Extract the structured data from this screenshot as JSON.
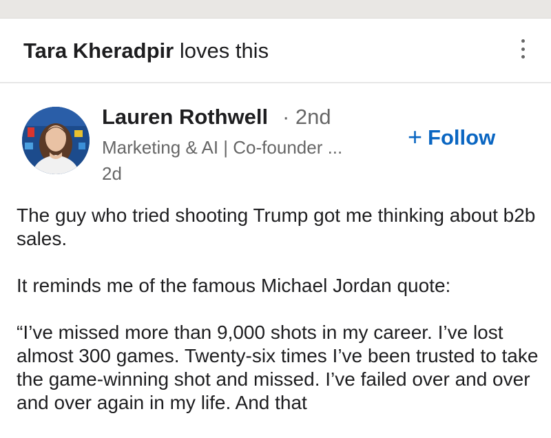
{
  "activity": {
    "actor_name": "Tara Kheradpir",
    "action_text": "loves this",
    "more_icon": "three-dots-vertical-icon"
  },
  "post": {
    "author": {
      "name": "Lauren Rothwell",
      "degree": "· 2nd",
      "headline": "Marketing & AI | Co-founder ...",
      "time": "2d"
    },
    "follow_button": {
      "plus": "+",
      "label": "Follow"
    },
    "paragraphs": [
      "The guy who tried shooting Trump got me thinking about b2b sales.",
      "It reminds me of the famous Michael Jordan quote:",
      "“I’ve missed more than 9,000 shots in my career. I’ve lost almost 300 games. Twenty-six times I’ve been trusted to take the game-winning shot and missed. I’ve failed over and over and over again in my life. And that"
    ]
  },
  "colors": {
    "link_blue": "#0a66c2",
    "secondary_text": "#666666",
    "primary_text": "#1d1d1f"
  }
}
